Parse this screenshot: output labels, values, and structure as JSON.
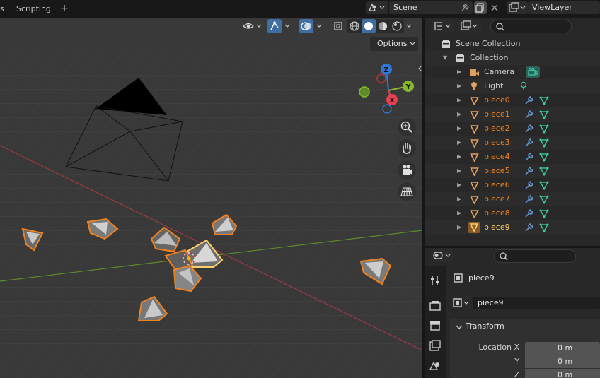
{
  "topbar": {
    "tab_partial": "s",
    "tab_scripting": "Scripting",
    "add_tab": "+",
    "scene_name": "Scene",
    "view_layer_name": "ViewLayer"
  },
  "viewport": {
    "options_label": "Options",
    "gizmo": {
      "z": "Z",
      "y": "Y",
      "x": "X"
    }
  },
  "outliner": {
    "scene_collection": "Scene Collection",
    "collection": "Collection",
    "items": [
      {
        "label": "Camera",
        "type": "camera"
      },
      {
        "label": "Light",
        "type": "light"
      },
      {
        "label": "piece0",
        "type": "mesh"
      },
      {
        "label": "piece1",
        "type": "mesh"
      },
      {
        "label": "piece2",
        "type": "mesh"
      },
      {
        "label": "piece3",
        "type": "mesh"
      },
      {
        "label": "piece4",
        "type": "mesh"
      },
      {
        "label": "piece5",
        "type": "mesh"
      },
      {
        "label": "piece6",
        "type": "mesh"
      },
      {
        "label": "piece7",
        "type": "mesh"
      },
      {
        "label": "piece8",
        "type": "mesh"
      },
      {
        "label": "piece9",
        "type": "mesh",
        "active": true
      }
    ]
  },
  "properties": {
    "object_name": "piece9",
    "datablock_name": "piece9",
    "transform_label": "Transform",
    "location_x_label": "Location X",
    "location_x_value": "0 m",
    "y_label": "Y",
    "y_value": "0 m",
    "z_label": "Z",
    "z_value": "0 m"
  },
  "colors": {
    "selected_orange": "#f0831f",
    "active_yellow": "#ffcf6b",
    "axis_x_red": "#e8404f",
    "axis_y_green": "#86b82a",
    "axis_z_blue": "#2f79d6",
    "modifier_blue": "#6b9bd6",
    "mesh_green": "#3ed1a3"
  }
}
